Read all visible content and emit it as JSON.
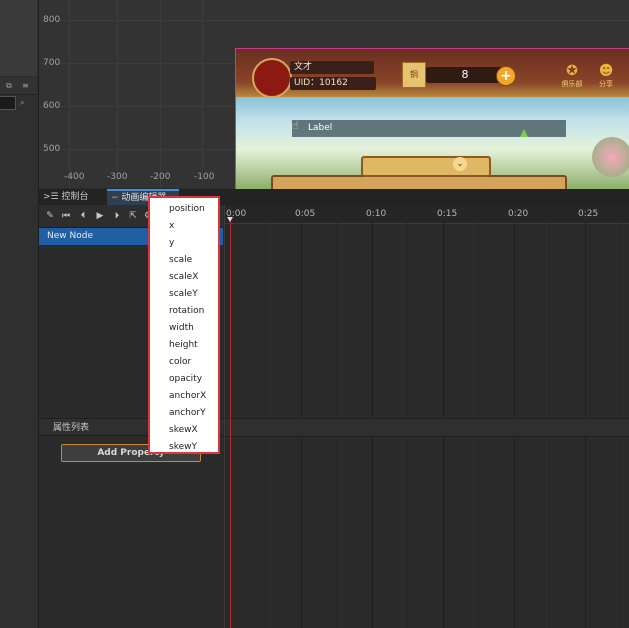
{
  "scene": {
    "y_ticks": [
      "800",
      "700",
      "600",
      "500"
    ],
    "x_ticks": [
      "-400",
      "-300",
      "-200",
      "-100"
    ]
  },
  "game": {
    "player_name": "文才",
    "uid": "UID：10162",
    "coin_value": "8",
    "coin_icon_label": "铜",
    "plus_label": "+",
    "icon_a_label": "俱乐部",
    "icon_b_label": "分享",
    "label_text": "Label",
    "chevron": "⌄"
  },
  "tabs": {
    "console": "控制台",
    "console_icon": ">☰",
    "animation": "动画编辑器",
    "animation_icon": "∽"
  },
  "toolbar_icons": [
    "edit-icon",
    "skip-start-icon",
    "step-back-icon",
    "play-icon",
    "step-forward-icon",
    "export-icon",
    "settings-icon"
  ],
  "node_list": {
    "items": [
      "New Node"
    ]
  },
  "timeline": {
    "labels": [
      "0:00",
      "0:05",
      "0:10",
      "0:15",
      "0:20",
      "0:25"
    ]
  },
  "properties": {
    "header": "属性列表",
    "add_button": "Add Property"
  },
  "dropdown": {
    "items": [
      "position",
      "x",
      "y",
      "scale",
      "scaleX",
      "scaleY",
      "rotation",
      "width",
      "height",
      "color",
      "opacity",
      "anchorX",
      "anchorY",
      "skewX",
      "skewY"
    ]
  },
  "colors": {
    "accent_red": "#d9363e",
    "selection_blue": "#1e5fa6",
    "button_border": "#c88a2e"
  }
}
